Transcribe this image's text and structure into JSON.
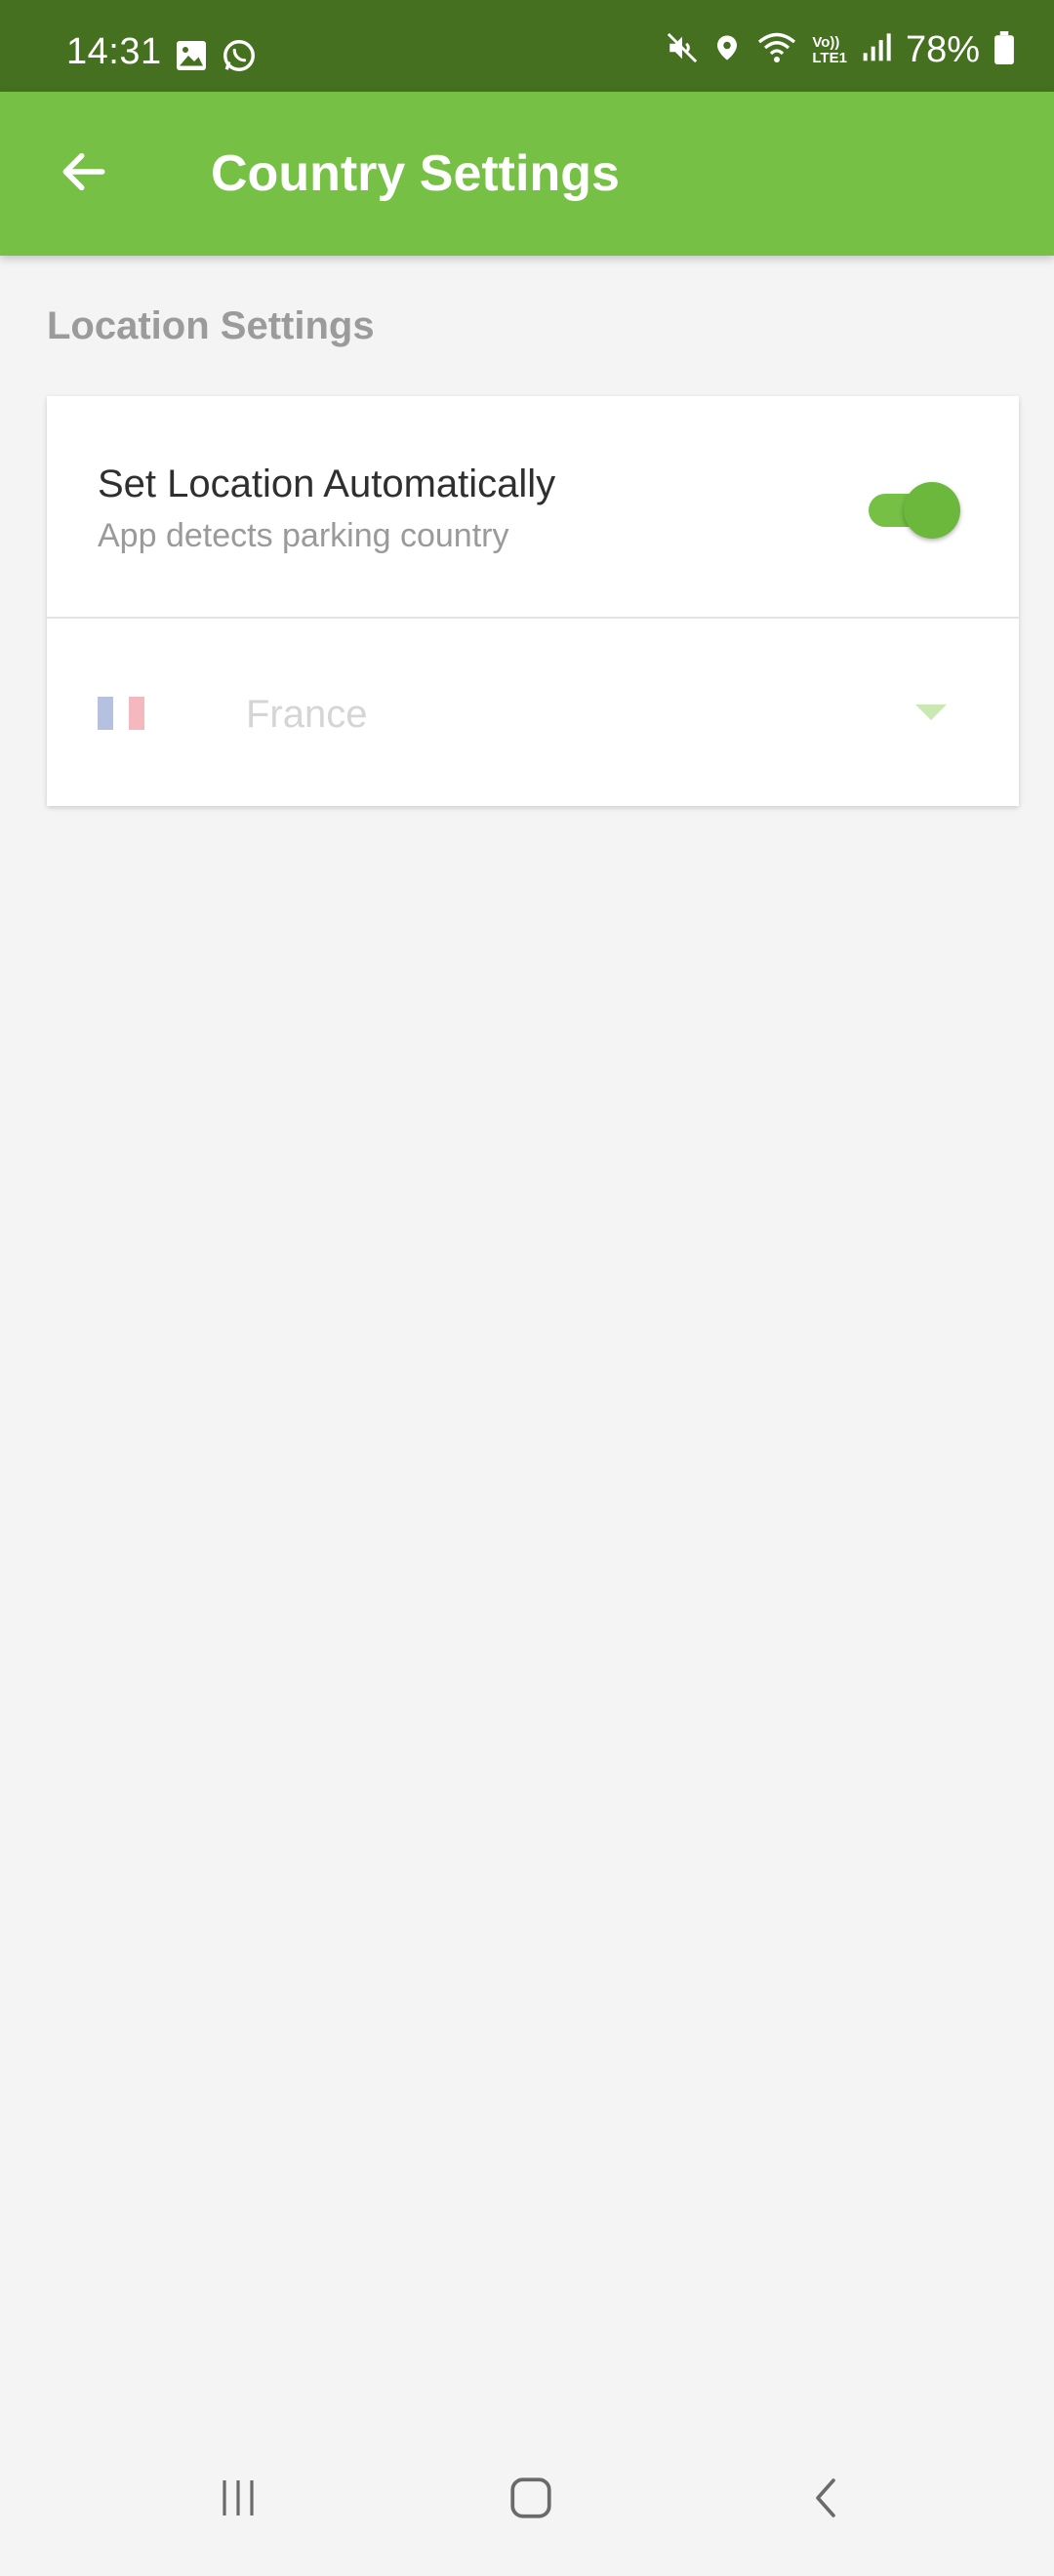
{
  "status_bar": {
    "time": "14:31",
    "left_icons": [
      "gallery-icon",
      "whatsapp-icon"
    ],
    "right_icons": [
      "vibrate-mute-icon",
      "location-pin-icon",
      "wifi-icon",
      "volte-icon",
      "signal-icon"
    ],
    "volte_label_top": "Vo))",
    "volte_label_bottom": "LTE1",
    "battery_percent": "78%",
    "battery_level": 0.78
  },
  "app_bar": {
    "title": "Country Settings",
    "back_icon": "arrow-left-icon",
    "background_color": "#76c045"
  },
  "section": {
    "label": "Location Settings"
  },
  "auto_location": {
    "title": "Set Location Automatically",
    "subtitle": "App detects parking country",
    "enabled": true
  },
  "country_select": {
    "selected_value": "France",
    "flag": "france-flag-icon",
    "disabled": true
  },
  "nav_bar": {
    "buttons": [
      "recent-apps-icon",
      "home-icon",
      "back-icon"
    ]
  },
  "colors": {
    "status_bar": "#44701f",
    "accent": "#76c045",
    "background": "#f4f4f4"
  }
}
